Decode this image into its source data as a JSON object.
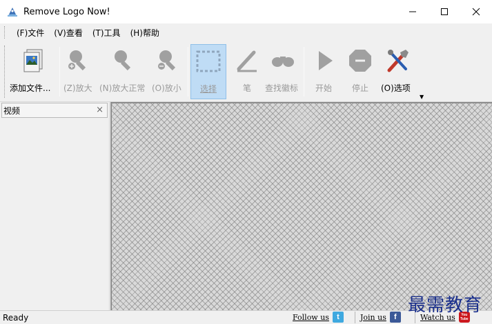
{
  "window": {
    "title": "Remove Logo Now!",
    "icon": "app-logo-icon",
    "controls": [
      "minimize-icon",
      "maximize-icon",
      "close-icon"
    ]
  },
  "menu": [
    {
      "label": "(F)文件"
    },
    {
      "label": "(V)查看"
    },
    {
      "label": "(T)工具"
    },
    {
      "label": "(H)帮助"
    }
  ],
  "toolbar": {
    "add_file": {
      "label": "添加文件...",
      "icon": "add-file-icon",
      "enabled": true
    },
    "zoom_in": {
      "label": "(Z)放大",
      "icon": "zoom-in-icon",
      "enabled": false
    },
    "zoom_normal": {
      "label": "(N)放大正常",
      "icon": "zoom-normal-icon",
      "enabled": false
    },
    "zoom_out": {
      "label": "(O)放小",
      "icon": "zoom-out-icon",
      "enabled": false
    },
    "select": {
      "label": "选择",
      "icon": "select-icon",
      "enabled": false,
      "selected": true
    },
    "pen": {
      "label": "笔",
      "icon": "pen-icon",
      "enabled": false
    },
    "find_logo": {
      "label": "查找徽标",
      "icon": "binoculars-icon",
      "enabled": false
    },
    "start": {
      "label": "开始",
      "icon": "play-icon",
      "enabled": false
    },
    "stop": {
      "label": "停止",
      "icon": "stop-icon",
      "enabled": false
    },
    "options": {
      "label": "(O)选项",
      "icon": "options-icon",
      "enabled": true
    }
  },
  "panel": {
    "title": "视频",
    "close": "×"
  },
  "status": {
    "text": "Ready",
    "follow_label": "Follow us",
    "join_label": "Join us",
    "watch_label": "Watch us",
    "follow_icon": "t",
    "join_icon": "f",
    "watch_icon": "You Tube"
  },
  "watermark": "最需教育",
  "colors": {
    "selected_bg": "#bfdcf5",
    "disabled_icon": "#a0a0a0",
    "twitter": "#3fa9e0",
    "facebook": "#3b5998",
    "youtube": "#cc181e",
    "watermark": "#1a2f8c"
  }
}
